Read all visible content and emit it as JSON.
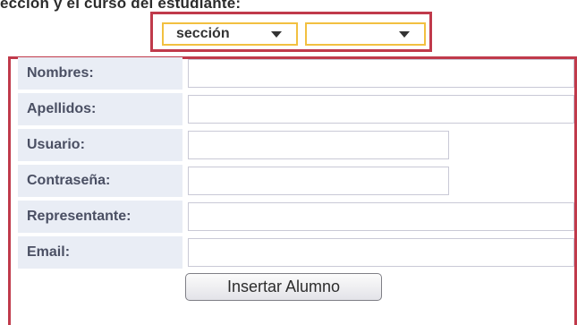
{
  "instruction": "ección y el curso del estudiante:",
  "selects": [
    {
      "value": "sección"
    },
    {
      "value": ""
    }
  ],
  "form": {
    "fields": [
      {
        "label": "Nombres:",
        "value": ""
      },
      {
        "label": "Apellidos:",
        "value": ""
      },
      {
        "label": "Usuario:",
        "value": ""
      },
      {
        "label": "Contraseña:",
        "value": ""
      },
      {
        "label": "Representante:",
        "value": ""
      },
      {
        "label": "Email:",
        "value": ""
      }
    ],
    "submit_label": "Insertar Alumno"
  },
  "colors": {
    "highlight_border": "#c03a4b",
    "select_border": "#f2c040",
    "label_bg": "#e9edf5",
    "label_text": "#4a4f63"
  }
}
